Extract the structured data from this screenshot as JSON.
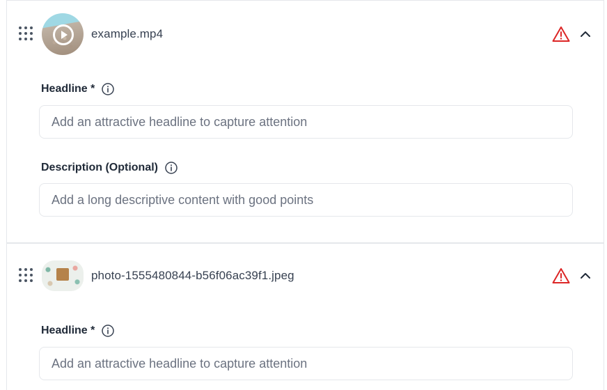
{
  "items": [
    {
      "file_name": "example.mp4",
      "thumbnail_type": "video",
      "status_icon": "warning-triangle-icon",
      "toggle_icon": "chevron-up-icon",
      "fields": {
        "headline_label": "Headline *",
        "headline_placeholder": "Add an attractive headline to capture attention",
        "description_label": "Description (Optional)",
        "description_placeholder": "Add a long descriptive content with good points"
      }
    },
    {
      "file_name": "photo-1555480844-b56f06ac39f1.jpeg",
      "thumbnail_type": "image",
      "status_icon": "warning-triangle-icon",
      "toggle_icon": "chevron-up-icon",
      "fields": {
        "headline_label": "Headline *",
        "headline_placeholder": "Add an attractive headline to capture attention"
      }
    }
  ],
  "colors": {
    "warning": "#dc2626",
    "border": "#e5e7eb",
    "text": "#1f2937",
    "placeholder": "#6b7280"
  }
}
